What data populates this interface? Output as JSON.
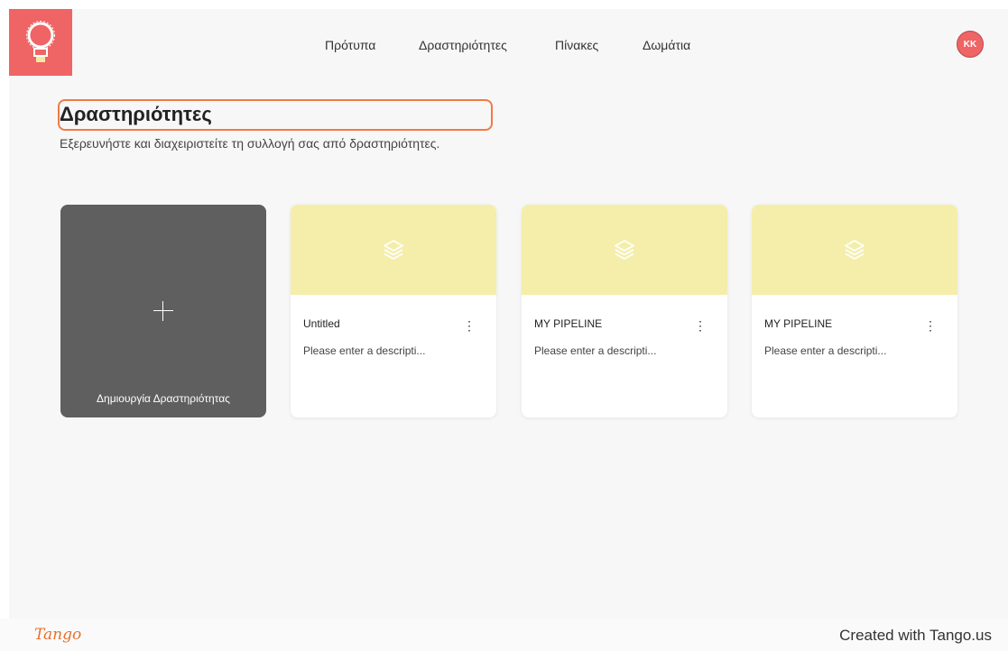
{
  "nav": {
    "items": [
      {
        "label": "Πρότυπα"
      },
      {
        "label": "Δραστηριότητες"
      },
      {
        "label": "Πίνακες"
      },
      {
        "label": "Δωμάτια"
      }
    ]
  },
  "user": {
    "initials": "KK"
  },
  "page": {
    "title": "Δραστηριότητες",
    "subtitle": "Εξερευνήστε και διαχειριστείτε τη συλλογή σας από δραστηριότητες."
  },
  "create_card": {
    "label": "Δημιουργία Δραστηριότητας"
  },
  "cards": [
    {
      "name": "Untitled",
      "description": "Please enter a descripti...",
      "menu": "⋮"
    },
    {
      "name": "MY PIPELINE",
      "description": "Please enter a descripti...",
      "menu": "⋮"
    },
    {
      "name": "MY PIPELINE",
      "description": "Please enter a descripti...",
      "menu": "⋮"
    }
  ],
  "footer": {
    "brand": "Tango",
    "credit": "Created with Tango.us"
  },
  "colors": {
    "accent": "#ef6464",
    "highlight": "#f07a45",
    "card_header": "#f4eeaa",
    "create_card": "#5f5f5f"
  }
}
